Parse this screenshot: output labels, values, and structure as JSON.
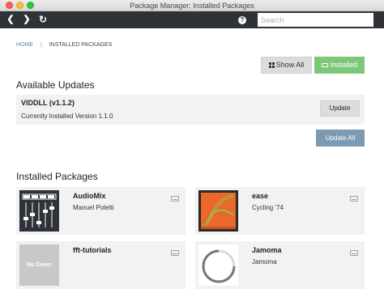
{
  "window": {
    "title": "Package Manager: Installed Packages"
  },
  "toolbar": {
    "back_icon": "chevron-left-icon",
    "forward_icon": "chevron-right-icon",
    "refresh_icon": "refresh-icon",
    "help_icon": "help-icon",
    "search_placeholder": "Search",
    "search_value": ""
  },
  "breadcrumb": {
    "home": "HOME",
    "current": "INSTALLED PACKAGES"
  },
  "filters": {
    "show_all": "Show All",
    "installed": "Installed",
    "installed_color": "#7dc67a"
  },
  "updates": {
    "title": "Available Updates",
    "item": {
      "name": "VIDDLL (v1.1.2)",
      "status": "Currently Installed Version 1.1.0",
      "button": "Update"
    },
    "update_all": "Update All"
  },
  "installed": {
    "title": "Installed Packages",
    "packages": [
      {
        "name": "AudioMix",
        "author": "Manuel Poletti"
      },
      {
        "name": "ease",
        "author": "Cycling '74"
      },
      {
        "name": "fft-tutorials",
        "author": "",
        "cover": "No Cover"
      },
      {
        "name": "Jamoma",
        "author": "Jamoma"
      }
    ]
  }
}
